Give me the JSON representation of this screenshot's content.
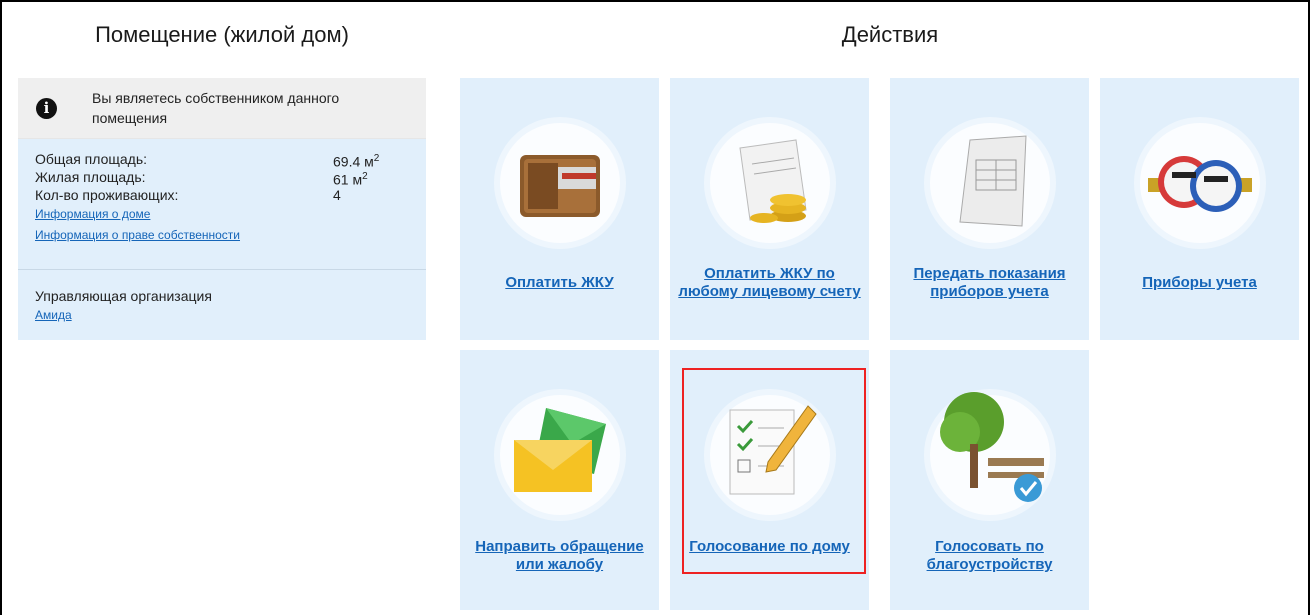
{
  "left": {
    "title": "Помещение (жилой дом)",
    "owner_text": "Вы являетесь собственником данного помещения",
    "stats": [
      {
        "label": "Общая площадь:",
        "value": "69.4 м",
        "unit_sup": "2"
      },
      {
        "label": "Жилая площадь:",
        "value": "61 м",
        "unit_sup": "2"
      },
      {
        "label": "Кол-во проживающих:",
        "value": "4",
        "unit_sup": ""
      }
    ],
    "links": [
      "Информация о доме",
      "Информация о праве собственности"
    ],
    "org_label": "Управляющая организация",
    "org_link": "Амида"
  },
  "right": {
    "title": "Действия",
    "tiles": [
      {
        "label": "Оплатить ЖКУ",
        "icon": "wallet-icon"
      },
      {
        "label": "Оплатить ЖКУ по любому лицевому счету",
        "icon": "bill-coins-icon"
      },
      {
        "label": "Передать показания приборов учета",
        "icon": "readings-sheet-icon"
      },
      {
        "label": "Приборы учета",
        "icon": "water-meter-icon"
      },
      {
        "label": "Направить обращение или жалобу",
        "icon": "envelopes-icon"
      },
      {
        "label": "Голосование по дому",
        "icon": "checklist-pencil-icon",
        "highlighted": true
      },
      {
        "label": "Голосовать по благоустройству",
        "icon": "tree-bench-icon"
      }
    ]
  },
  "colors": {
    "panel_bg": "#e1effb",
    "link": "#1565b8",
    "highlight": "#e22222"
  }
}
